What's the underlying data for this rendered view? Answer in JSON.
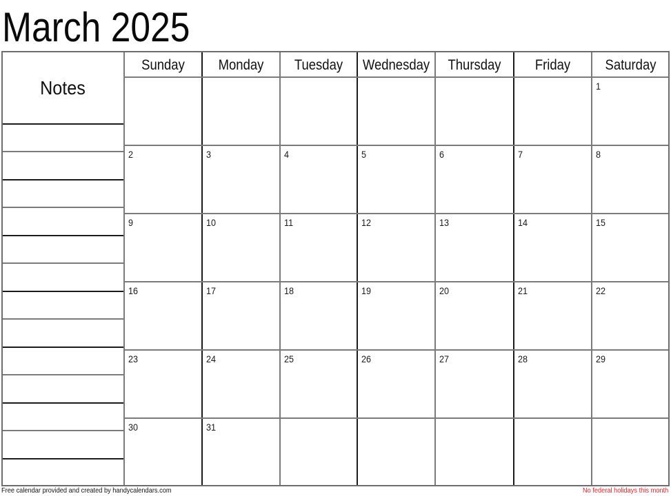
{
  "title": "March 2025",
  "notes_label": "Notes",
  "weekdays": [
    "Sunday",
    "Monday",
    "Tuesday",
    "Wednesday",
    "Thursday",
    "Friday",
    "Saturday"
  ],
  "weeks": [
    [
      "",
      "",
      "",
      "",
      "",
      "",
      "1"
    ],
    [
      "2",
      "3",
      "4",
      "5",
      "6",
      "7",
      "8"
    ],
    [
      "9",
      "10",
      "11",
      "12",
      "13",
      "14",
      "15"
    ],
    [
      "16",
      "17",
      "18",
      "19",
      "20",
      "21",
      "22"
    ],
    [
      "23",
      "24",
      "25",
      "26",
      "27",
      "28",
      "29"
    ],
    [
      "30",
      "31",
      "",
      "",
      "",
      "",
      ""
    ]
  ],
  "footer": {
    "credit": "Free calendar provided and created by handycalendars.com",
    "holidays": "No federal holidays this month"
  },
  "colors": {
    "holiday_note": "#e0242a"
  }
}
